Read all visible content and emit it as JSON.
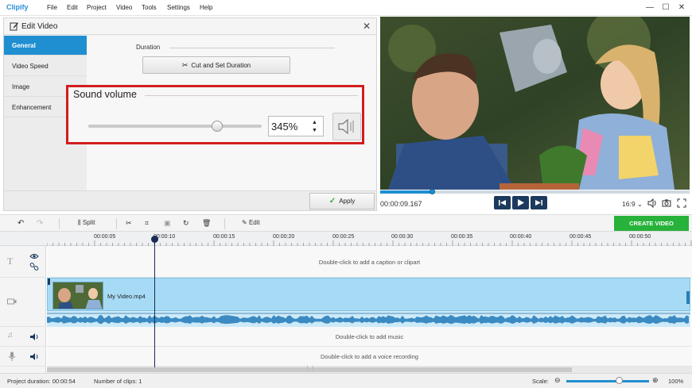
{
  "app": {
    "logo": "Clipify",
    "menu": [
      "File",
      "Edit",
      "Project",
      "Video",
      "Tools",
      "Settings",
      "Help"
    ],
    "window_controls": [
      "—",
      "☐",
      "✕"
    ]
  },
  "edit_panel": {
    "title": "Edit Video",
    "close": "✕",
    "tabs": [
      "General",
      "Video Speed",
      "Image",
      "Enhancement"
    ],
    "active_tab": "General",
    "duration_label": "Duration",
    "cut_button": "Cut and Set Duration",
    "sound_volume_label": "Sound volume",
    "volume_value": "345%",
    "volume_level_fraction": 0.75,
    "apply_button": "Apply"
  },
  "preview": {
    "time": "00:00:09.167",
    "aspect_ratio": "16:9",
    "progress_fraction": 0.17
  },
  "toolbar": {
    "split": "Split",
    "edit": "Edit",
    "create_video": "CREATE VIDEO"
  },
  "timeline": {
    "ticks": [
      "00:00:05",
      "00:00:10",
      "00:00:15",
      "00:00:20",
      "00:00:25",
      "00:00:30",
      "00:00:35",
      "00:00:40",
      "00:00:45",
      "00:00:50"
    ],
    "caption_hint": "Double-click to add a caption or clipart",
    "clip_name": "My Video.mp4",
    "music_hint": "Double-click to add music",
    "voice_hint": "Double-click to add a voice recording"
  },
  "status": {
    "project_duration": "Project duration: 00:00:54",
    "clips": "Number of clips: 1",
    "scale_label": "Scale:",
    "scale_value": "100%"
  },
  "colors": {
    "accent_blue": "#1f8fd1",
    "highlight_red": "#d21d1d",
    "create_green": "#27b23b",
    "clip_blue": "#a7dbf5"
  }
}
